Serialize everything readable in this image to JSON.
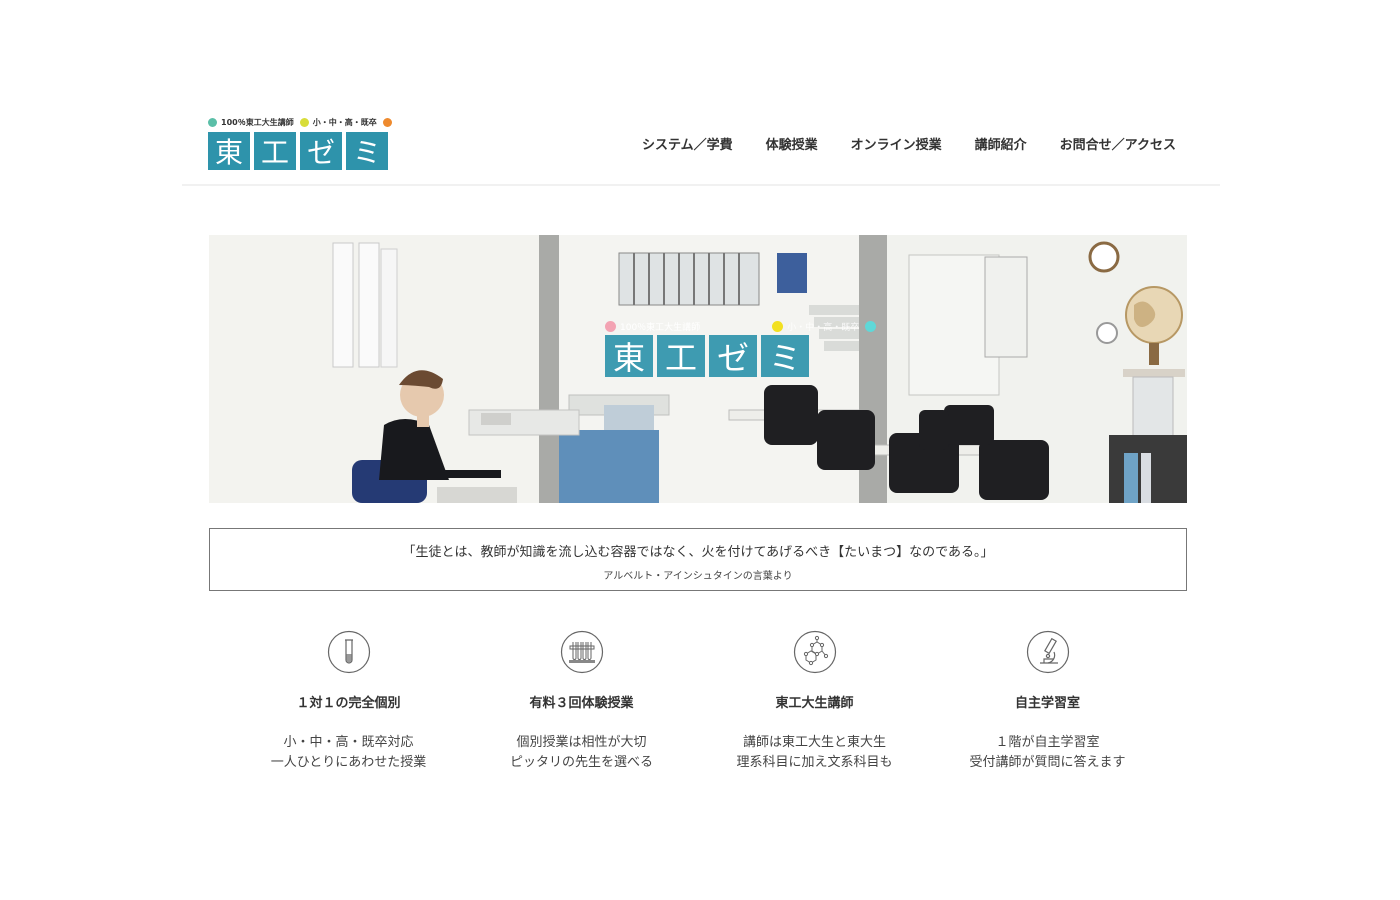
{
  "brand": {
    "tag1": "100％東工大生講師",
    "tag2": "小・中・高・既卒",
    "chars": [
      "東",
      "工",
      "ゼ",
      "ミ"
    ],
    "dot_colors": [
      "#5bbfa8",
      "#d8dd3a",
      "#ee8a2e"
    ],
    "box_color": "#2e93ab"
  },
  "nav": {
    "items": [
      "システム／学費",
      "体験授業",
      "オンライン授業",
      "講師紹介",
      "お問合せ／アクセス"
    ]
  },
  "hero": {
    "tagline": "100％東工大生講師",
    "tagline2": "小・中・高・既卒",
    "chars": [
      "東",
      "工",
      "ゼ",
      "ミ"
    ],
    "dot_colors": [
      "#f3a3b3",
      "#f2e021",
      "#5fd8d8"
    ]
  },
  "quote": {
    "text": "「生徒とは、教師が知識を流し込む容器ではなく、火を付けてあげるべき【たいまつ】なのである。」",
    "source": "アルベルト・アインシュタインの言葉より"
  },
  "features": [
    {
      "icon": "test-tube-icon",
      "title": "１対１の完全個別",
      "line1": "小・中・高・既卒対応",
      "line2": "一人ひとりにあわせた授業"
    },
    {
      "icon": "test-tube-rack-icon",
      "title": "有料３回体験授業",
      "line1": "個別授業は相性が大切",
      "line2": "ピッタリの先生を選べる"
    },
    {
      "icon": "molecule-icon",
      "title": "東工大生講師",
      "line1": "講師は東工大生と東大生",
      "line2": "理系科目に加え文系科目も"
    },
    {
      "icon": "microscope-icon",
      "title": "自主学習室",
      "line1": "１階が自主学習室",
      "line2": "受付講師が質問に答えます"
    }
  ]
}
